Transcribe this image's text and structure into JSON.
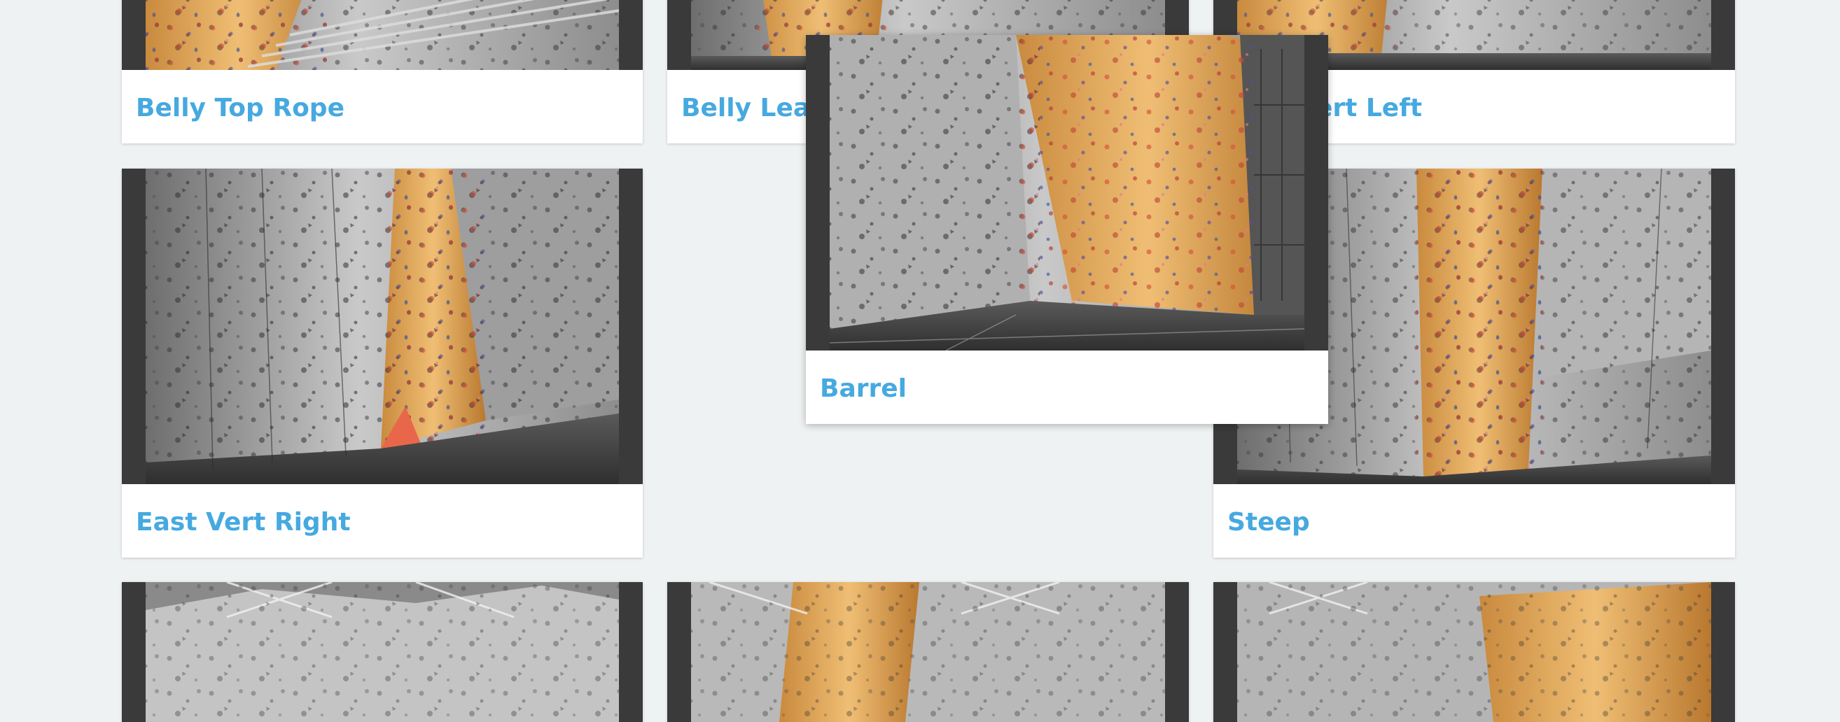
{
  "colors": {
    "page_background": "#eff2f3",
    "card_background": "#ffffff",
    "title_color": "#46a9e0",
    "wall_gray": "#bdbdbd",
    "wall_orange": "#e0a04e"
  },
  "icons": {
    "photo": "climbing-wall-photo"
  },
  "walls": {
    "belly_top_rope": {
      "title": "Belly Top Rope"
    },
    "belly_lead": {
      "title": "Belly Lead"
    },
    "east_vert_left": {
      "title": "East Vert Left"
    },
    "east_vert_right": {
      "title": "East Vert Right"
    },
    "steep": {
      "title": "Steep"
    },
    "barrel": {
      "title": "Barrel"
    }
  }
}
